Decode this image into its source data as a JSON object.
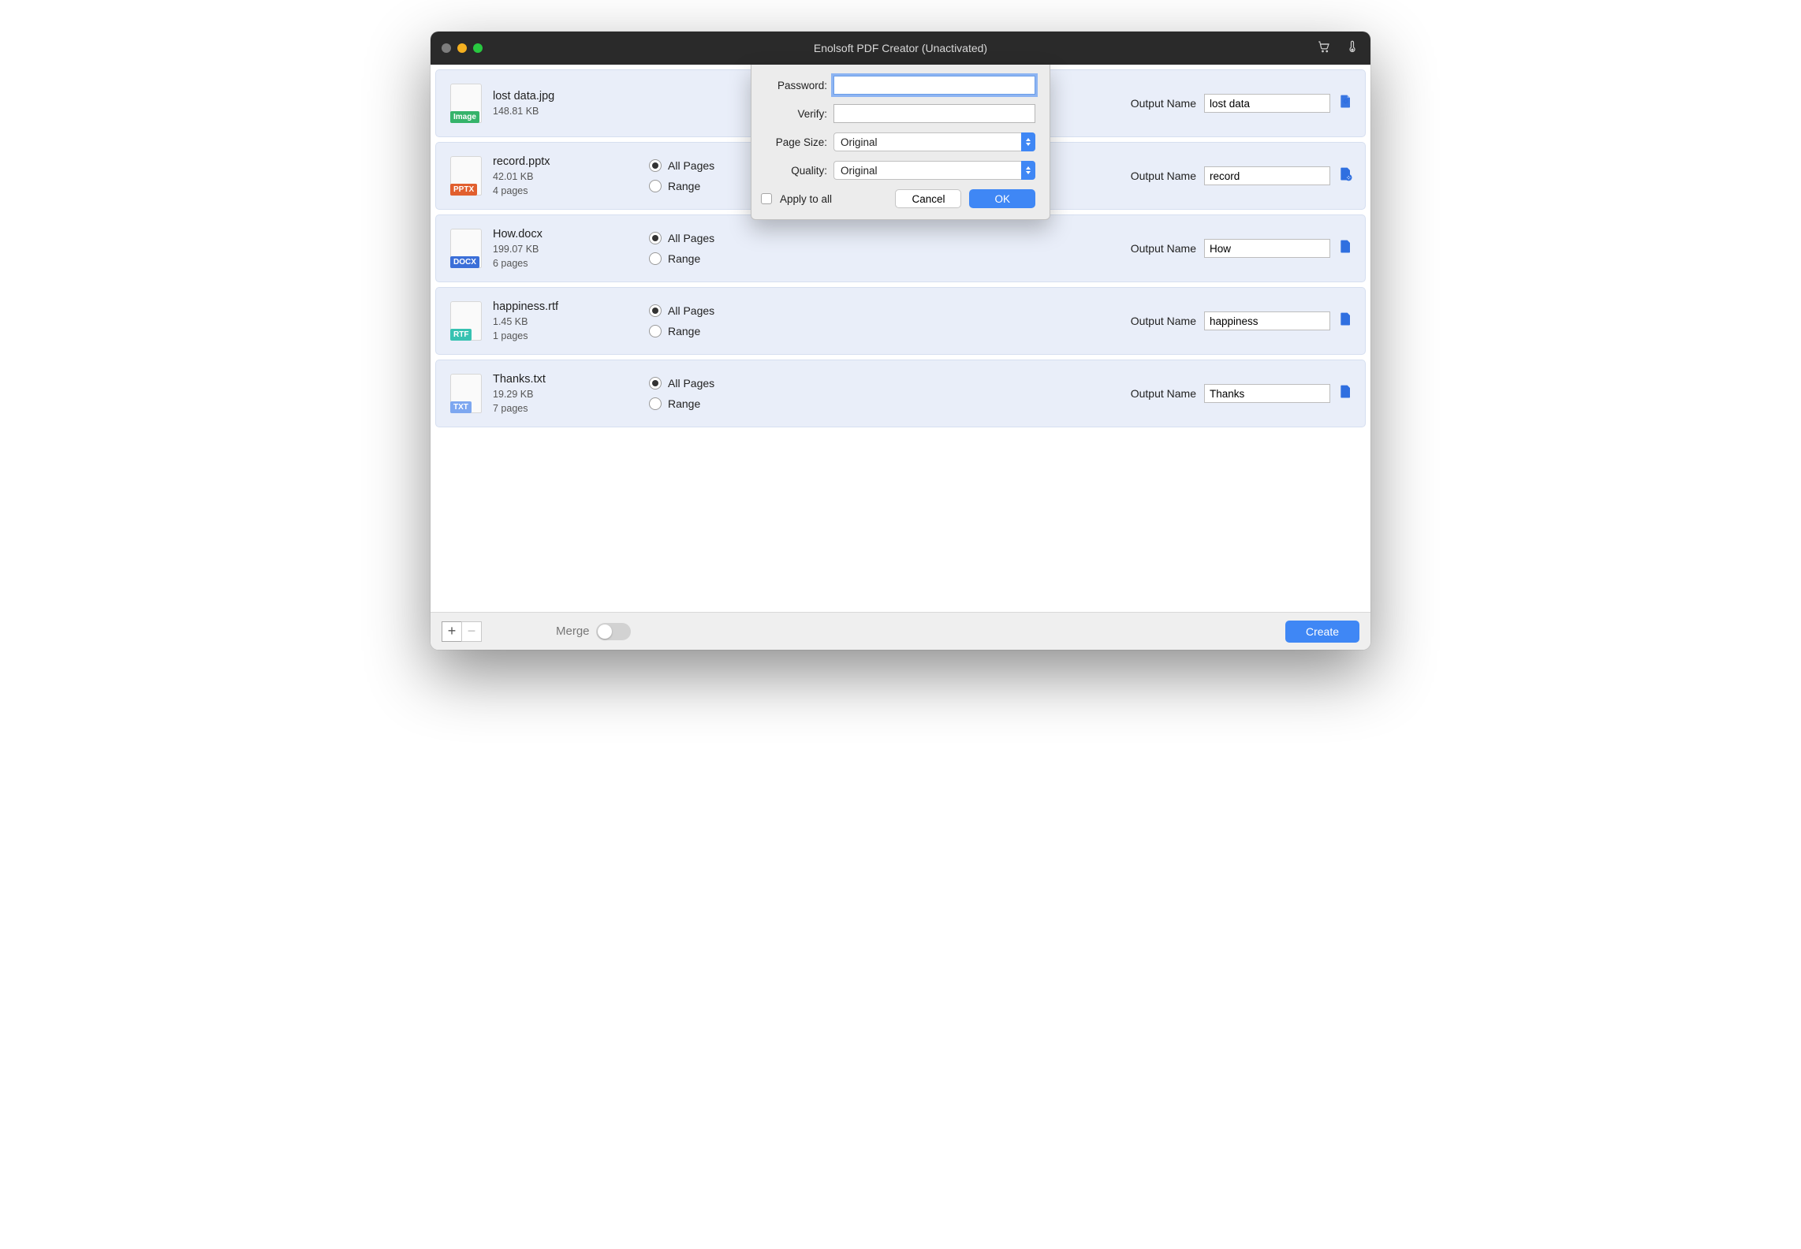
{
  "window": {
    "title": "Enolsoft PDF Creator (Unactivated)"
  },
  "labels": {
    "all_pages": "All Pages",
    "range": "Range",
    "output_name": "Output Name",
    "merge": "Merge",
    "create": "Create"
  },
  "files": [
    {
      "name": "lost data.jpg",
      "size": "148.81 KB",
      "pages": "",
      "type": "Image",
      "type_color": "#35b36a",
      "output": "lost data"
    },
    {
      "name": "record.pptx",
      "size": "42.01 KB",
      "pages": "4 pages",
      "type": "PPTX",
      "type_color": "#e15f2e",
      "output": "record"
    },
    {
      "name": "How.docx",
      "size": "199.07 KB",
      "pages": "6 pages",
      "type": "DOCX",
      "type_color": "#3b6fd8",
      "output": "How"
    },
    {
      "name": "happiness.rtf",
      "size": "1.45 KB",
      "pages": "1 pages",
      "type": "RTF",
      "type_color": "#37c2b1",
      "output": "happiness"
    },
    {
      "name": "Thanks.txt",
      "size": "19.29 KB",
      "pages": "7 pages",
      "type": "TXT",
      "type_color": "#7da7f0",
      "output": "Thanks"
    }
  ],
  "modal": {
    "password_label": "Password:",
    "verify_label": "Verify:",
    "page_size_label": "Page Size:",
    "page_size_value": "Original",
    "quality_label": "Quality:",
    "quality_value": "Original",
    "apply_all_label": "Apply to all",
    "cancel": "Cancel",
    "ok": "OK"
  },
  "footer": {
    "merge_on": false
  }
}
